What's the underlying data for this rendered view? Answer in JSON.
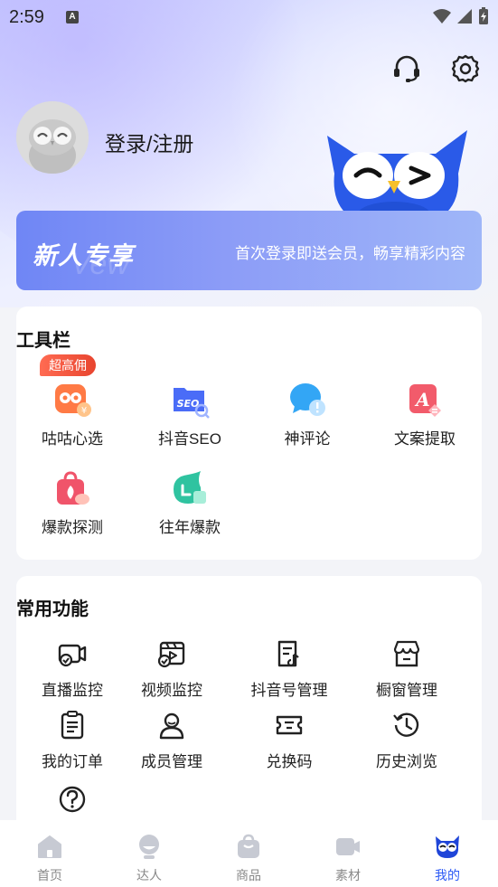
{
  "status_bar": {
    "time": "2:59",
    "a_icon": "A"
  },
  "header": {
    "support_icon": "headset-icon",
    "settings_icon": "gear-icon",
    "login_text": "登录/注册"
  },
  "banner": {
    "title": "新人专享",
    "description": "首次登录即送会员，畅享精彩内容"
  },
  "toolbar": {
    "title": "工具栏",
    "badge": "超高佣",
    "items": [
      {
        "label": "咕咕心选",
        "icon": "owl-shop-icon",
        "color": "#ff7a45"
      },
      {
        "label": "抖音SEO",
        "icon": "seo-folder-icon",
        "color": "#4a6cf7"
      },
      {
        "label": "神评论",
        "icon": "comment-bubble-icon",
        "color": "#33a6f5"
      },
      {
        "label": "文案提取",
        "icon": "text-extract-icon",
        "color": "#f25b6b"
      },
      {
        "label": "爆款探测",
        "icon": "hot-bag-icon",
        "color": "#f0546a"
      },
      {
        "label": "往年爆款",
        "icon": "history-hit-icon",
        "color": "#2fc3a0"
      }
    ]
  },
  "common": {
    "title": "常用功能",
    "items": [
      {
        "label": "直播监控",
        "icon": "live-monitor-icon"
      },
      {
        "label": "视频监控",
        "icon": "video-monitor-icon"
      },
      {
        "label": "抖音号管理",
        "icon": "account-manage-icon"
      },
      {
        "label": "橱窗管理",
        "icon": "storefront-icon"
      },
      {
        "label": "我的订单",
        "icon": "order-list-icon"
      },
      {
        "label": "成员管理",
        "icon": "member-icon"
      },
      {
        "label": "兑换码",
        "icon": "ticket-icon"
      },
      {
        "label": "历史浏览",
        "icon": "history-icon"
      },
      {
        "label": "",
        "icon": "help-icon"
      }
    ]
  },
  "tabs": [
    {
      "label": "首页",
      "icon": "home-icon",
      "active": false
    },
    {
      "label": "达人",
      "icon": "creator-icon",
      "active": false
    },
    {
      "label": "商品",
      "icon": "bag-icon",
      "active": false
    },
    {
      "label": "素材",
      "icon": "video-icon",
      "active": false
    },
    {
      "label": "我的",
      "icon": "owl-profile-icon",
      "active": true
    }
  ],
  "colors": {
    "accent": "#2b59f5",
    "banner_start": "#6f86f5",
    "badge": "#e8452f"
  }
}
